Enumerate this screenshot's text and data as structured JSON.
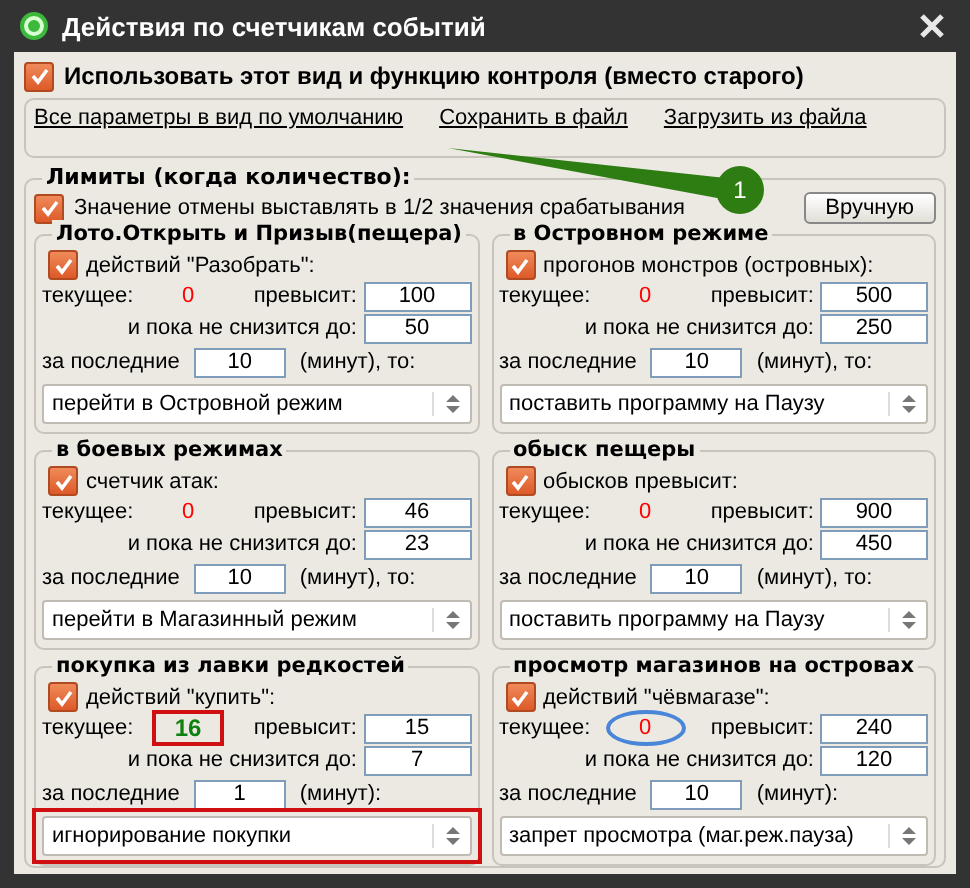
{
  "window": {
    "title": "Действия по счетчикам событий"
  },
  "use_new_view": {
    "label": "Использовать этот вид и функцию контроля (вместо старого)",
    "checked": true
  },
  "links": [
    "Все параметры в вид по умолчанию",
    "Сохранить в файл",
    "Загрузить из файла"
  ],
  "callout": {
    "label": "1"
  },
  "limits": {
    "title": "Лимиты (когда количество):",
    "half_cancel": {
      "label": "Значение отмены выставлять в 1/2 значения срабатывания",
      "checked": true
    },
    "manual_button": "Вручную",
    "groups": [
      {
        "title": "Лото.Открыть и Призыв(пещера)",
        "checkbox": {
          "label": "действий \"Разобрать\":",
          "checked": true
        },
        "current_label": "текущее:",
        "current": "0",
        "exceeded": false,
        "current_boxed": false,
        "current_circled": false,
        "exceeds_label": "превысит:",
        "exceeds": "100",
        "until_label": "и пока  не снизится до:",
        "until": "50",
        "period_label": "за последние",
        "minutes": "10",
        "minutes_label": "(минут), то:",
        "action": "перейти в Островной режим",
        "action_boxed": false
      },
      {
        "title": "в Островном режиме",
        "checkbox": {
          "label": "прогонов монстров (островных):",
          "checked": true
        },
        "current_label": "текущее:",
        "current": "0",
        "exceeded": false,
        "current_boxed": false,
        "current_circled": false,
        "exceeds_label": "превысит:",
        "exceeds": "500",
        "until_label": "и пока  не снизится до:",
        "until": "250",
        "period_label": "за последние",
        "minutes": "10",
        "minutes_label": "(минут), то:",
        "action": "поставить программу на Паузу",
        "action_boxed": false
      },
      {
        "title": "в боевых режимах",
        "checkbox": {
          "label": "счетчик атак:",
          "checked": true
        },
        "current_label": "текущее:",
        "current": "0",
        "exceeded": false,
        "current_boxed": false,
        "current_circled": false,
        "exceeds_label": "превысит:",
        "exceeds": "46",
        "until_label": "и пока  не снизится до:",
        "until": "23",
        "period_label": "за последние",
        "minutes": "10",
        "minutes_label": "(минут), то:",
        "action": "перейти в Магазинный режим",
        "action_boxed": false
      },
      {
        "title": "обыск пещеры",
        "checkbox": {
          "label": "обысков превысит:",
          "checked": true
        },
        "current_label": "текущее:",
        "current": "0",
        "exceeded": false,
        "current_boxed": false,
        "current_circled": false,
        "exceeds_label": "превысит:",
        "exceeds": "900",
        "until_label": "и пока  не снизится до:",
        "until": "450",
        "period_label": "за последние",
        "minutes": "10",
        "minutes_label": "(минут), то:",
        "action": "поставить программу на Паузу",
        "action_boxed": false
      },
      {
        "title": "покупка из лавки редкостей",
        "checkbox": {
          "label": "действий \"купить\":",
          "checked": true
        },
        "current_label": "текущее:",
        "current": "16",
        "exceeded": true,
        "current_boxed": true,
        "current_circled": false,
        "exceeds_label": "превысит:",
        "exceeds": "15",
        "until_label": "и пока  не снизится до:",
        "until": "7",
        "period_label": "за последние",
        "minutes": "1",
        "minutes_label": "(минут):",
        "action": "игнорирование покупки",
        "action_boxed": true
      },
      {
        "title": "просмотр магазинов на островах",
        "checkbox": {
          "label": "действий \"чёвмагазе\":",
          "checked": true
        },
        "current_label": "текущее:",
        "current": "0",
        "exceeded": false,
        "current_boxed": false,
        "current_circled": true,
        "exceeds_label": "превысит:",
        "exceeds": "240",
        "until_label": "и пока не снизится до:",
        "until": "120",
        "period_label": "за последние",
        "minutes": "10",
        "minutes_label": "(минут):",
        "action": "запрет просмотра (маг.реж.пауза)",
        "action_boxed": false
      }
    ]
  }
}
